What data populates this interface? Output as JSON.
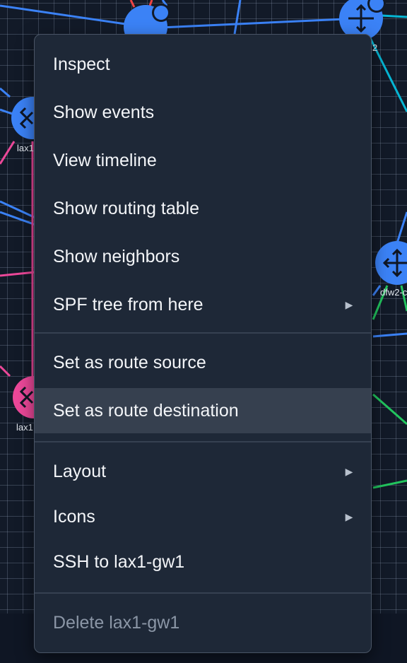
{
  "topology": {
    "node_labels": {
      "lax1_top": "lax1",
      "lax1_bottom": "lax1",
      "dfw2": "dfw2-c",
      "top_right": "2"
    },
    "colors": {
      "router_blue": "#3b82f6",
      "router_pink": "#ec4899",
      "link_blue": "#3b82f6",
      "link_cyan": "#06b6d4",
      "link_green": "#22c55e",
      "link_pink": "#ec4899",
      "link_red": "#ef4444"
    }
  },
  "context_menu": {
    "items": [
      {
        "label": "Inspect"
      },
      {
        "label": "Show events"
      },
      {
        "label": "View timeline"
      },
      {
        "label": "Show routing table"
      },
      {
        "label": "Show neighbors"
      },
      {
        "label": "SPF tree from here",
        "submenu_icon": "chevron-right-icon"
      },
      {
        "label": "Set as route source"
      },
      {
        "label": "Set as route destination",
        "hovered": true
      },
      {
        "label": "Layout",
        "submenu_icon": "chevron-right-icon"
      },
      {
        "label": "Icons",
        "submenu_icon": "chevron-right-icon"
      },
      {
        "label": "SSH to lax1-gw1"
      },
      {
        "label": "Delete lax1-gw1",
        "disabled": true
      }
    ],
    "submenu_glyph": "▶"
  }
}
